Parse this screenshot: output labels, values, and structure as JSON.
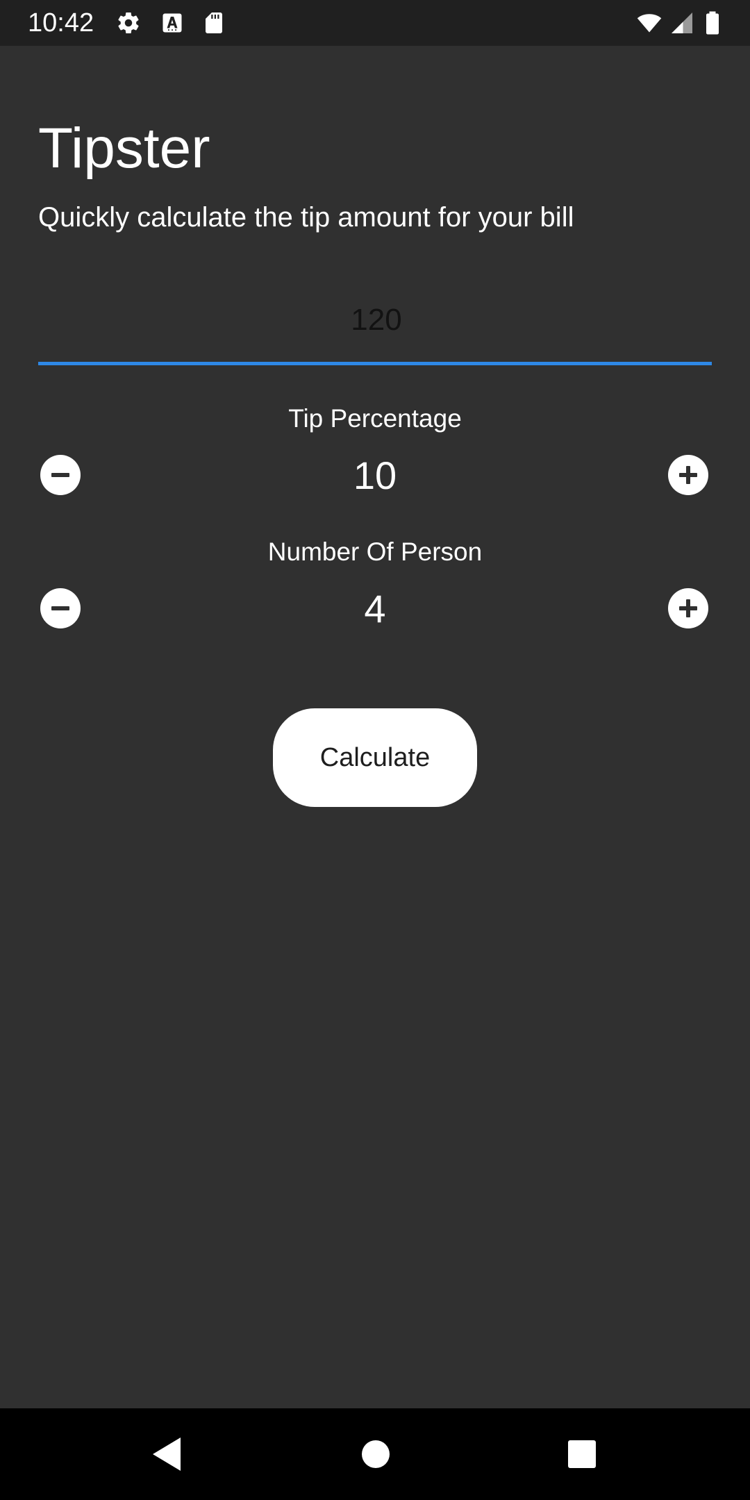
{
  "status_bar": {
    "time": "10:42",
    "left_icons": [
      "gear-icon",
      "font-a-icon",
      "sd-card-icon"
    ],
    "right_icons": [
      "wifi-icon",
      "cell-signal-icon",
      "battery-icon"
    ]
  },
  "app": {
    "title": "Tipster",
    "subtitle": "Quickly calculate the tip amount for your bill"
  },
  "bill_input": {
    "value": "120"
  },
  "tip": {
    "label": "Tip Percentage",
    "value": "10"
  },
  "persons": {
    "label": "Number Of Person",
    "value": "4"
  },
  "calculate_label": "Calculate",
  "nav": {
    "icons": [
      "back-icon",
      "home-icon",
      "recents-icon"
    ]
  },
  "colors": {
    "background": "#303030",
    "status_bar": "#202020",
    "accent": "#2e88e6",
    "button": "#ffffff",
    "nav_bar": "#000000"
  }
}
